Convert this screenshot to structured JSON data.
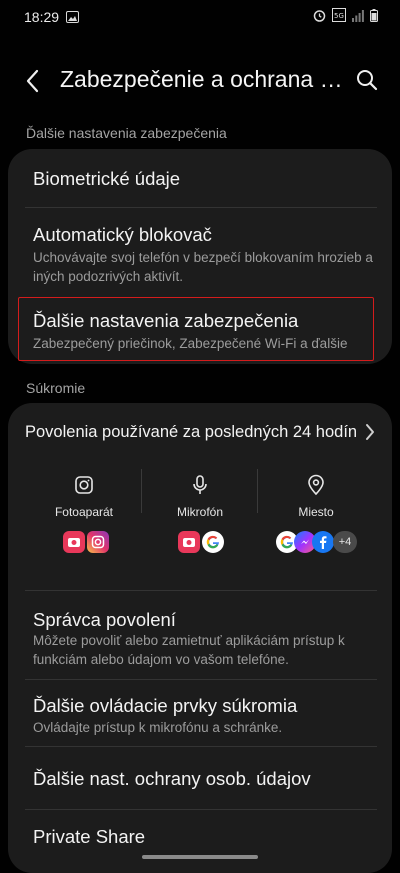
{
  "status_bar": {
    "time": "18:29"
  },
  "header": {
    "title": "Zabezpečenie a ochrana osobných údajov"
  },
  "section1": {
    "label": "Ďalšie nastavenia zabezpečenia"
  },
  "card1": {
    "biometric": {
      "title": "Biometrické údaje"
    },
    "auto_blocker": {
      "title": "Automatický blokovač",
      "subtitle": "Uchovávajte svoj telefón v bezpečí blokovaním hrozieb a iných podozrivých aktivít."
    },
    "more_security": {
      "title": "Ďalšie nastavenia zabezpečenia",
      "subtitle": "Zabezpečený priečinok, Zabezpečené Wi-Fi a ďalšie"
    }
  },
  "section2": {
    "label": "Súkromie"
  },
  "card2": {
    "permissions_header": "Povolenia používané za posledných 24 hodín",
    "columns": [
      {
        "label": "Fotoaparát",
        "icon": "camera-icon"
      },
      {
        "label": "Mikrofón",
        "icon": "microphone-icon"
      },
      {
        "label": "Miesto",
        "icon": "location-icon"
      }
    ],
    "extra_apps": "+4",
    "permission_manager": {
      "title": "Správca povolení",
      "subtitle": "Môžete povoliť alebo zamietnuť aplikáciám prístup k funkciám alebo údajom vo vašom telefóne."
    },
    "privacy_controls": {
      "title": "Ďalšie ovládacie prvky súkromia",
      "subtitle": "Ovládajte prístup k mikrofónu a schránke."
    },
    "data_protection": {
      "title": "Ďalšie nast. ochrany osob. údajov"
    },
    "private_share": {
      "title": "Private Share"
    }
  },
  "colors": {
    "highlight": "#d41c1c",
    "card": "#1c1c1c",
    "background": "#010101"
  }
}
